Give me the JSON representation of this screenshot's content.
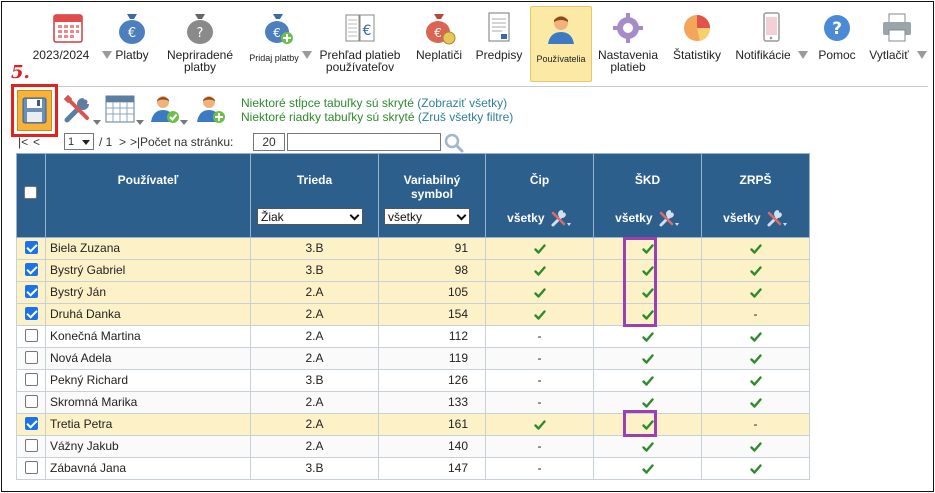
{
  "toolbar": {
    "items": [
      {
        "label": "2023/2024",
        "icon": "calendar-icon",
        "dropdown": true
      },
      {
        "label": "Platby",
        "icon": "money-bag-euro-icon"
      },
      {
        "label": "Nepriradené platby",
        "icon": "money-bag-question-icon"
      },
      {
        "label": "Pridaj platby",
        "icon": "money-bag-add-icon",
        "dropdown": true
      },
      {
        "label": "Prehľad platieb používateľov",
        "icon": "ledger-euro-icon"
      },
      {
        "label": "Neplatiči",
        "icon": "money-bag-debtor-icon"
      },
      {
        "label": "Predpisy",
        "icon": "document-icon"
      },
      {
        "label": "Používatelia",
        "icon": "user-icon",
        "active": true
      },
      {
        "label": "Nastavenia platieb",
        "icon": "gear-icon"
      },
      {
        "label": "Štatistiky",
        "icon": "pie-chart-icon"
      },
      {
        "label": "Notifikácie",
        "icon": "phone-icon",
        "dropdown": true
      },
      {
        "label": "Pomoc",
        "icon": "help-icon"
      },
      {
        "label": "Vytlačiť",
        "icon": "printer-icon",
        "dropdown": true
      }
    ]
  },
  "step_marker": "5.",
  "notices": {
    "columns_hidden": "Niektoré stĺpce tabuľky sú skryté",
    "columns_link": "(Zobraziť všetky)",
    "rows_hidden": "Niektoré riadky tabuľky sú skryté",
    "rows_link": "(Zruš všetky filtre)"
  },
  "pager": {
    "first": "|<",
    "prev": "<",
    "current": "1",
    "of": "/ 1",
    "next": ">",
    "last": ">|",
    "per_page_label": "Počet na stránku:",
    "per_page_value": "20"
  },
  "table": {
    "headers": {
      "user": "Používateľ",
      "class": "Trieda",
      "vs_line1": "Variabilný",
      "vs_line2": "symbol",
      "chip": "Čip",
      "skd": "ŠKD",
      "zrps": "ZRPŠ"
    },
    "filters": {
      "class": "Žiak",
      "vs": "všetky",
      "chip": "všetky",
      "skd": "všetky",
      "zrps": "všetky"
    },
    "rows": [
      {
        "checked": true,
        "name": "Biela Zuzana",
        "class": "3.B",
        "vs": "91",
        "chip": "✔",
        "skd": "✔",
        "zrps": "✔"
      },
      {
        "checked": true,
        "name": "Bystrý Gabriel",
        "class": "3.B",
        "vs": "98",
        "chip": "✔",
        "skd": "✔",
        "zrps": "✔"
      },
      {
        "checked": true,
        "name": "Bystrý Ján",
        "class": "2.A",
        "vs": "105",
        "chip": "✔",
        "skd": "✔",
        "zrps": "✔"
      },
      {
        "checked": true,
        "name": "Druhá Danka",
        "class": "2.A",
        "vs": "154",
        "chip": "✔",
        "skd": "✔",
        "zrps": "-"
      },
      {
        "checked": false,
        "name": "Konečná Martina",
        "class": "2.A",
        "vs": "112",
        "chip": "-",
        "skd": "✔",
        "zrps": "✔"
      },
      {
        "checked": false,
        "name": "Nová Adela",
        "class": "2.A",
        "vs": "119",
        "chip": "-",
        "skd": "✔",
        "zrps": "✔"
      },
      {
        "checked": false,
        "name": "Pekný Richard",
        "class": "3.B",
        "vs": "126",
        "chip": "-",
        "skd": "✔",
        "zrps": "✔"
      },
      {
        "checked": false,
        "name": "Skromná Marika",
        "class": "2.A",
        "vs": "133",
        "chip": "-",
        "skd": "✔",
        "zrps": "✔"
      },
      {
        "checked": true,
        "name": "Tretia Petra",
        "class": "2.A",
        "vs": "161",
        "chip": "✔",
        "skd": "✔",
        "zrps": "-"
      },
      {
        "checked": false,
        "name": "Vážny Jakub",
        "class": "2.A",
        "vs": "140",
        "chip": "-",
        "skd": "✔",
        "zrps": "✔"
      },
      {
        "checked": false,
        "name": "Zábavná Jana",
        "class": "3.B",
        "vs": "147",
        "chip": "-",
        "skd": "✔",
        "zrps": "✔"
      }
    ]
  },
  "colors": {
    "header_bg": "#2d5f8c",
    "selected_row_bg": "#fdf1c7",
    "check_green": "#2e8b2e",
    "highlight_red": "#e02222",
    "highlight_purple": "#9b3fb5",
    "active_tab_bg": "#fde9a6"
  }
}
